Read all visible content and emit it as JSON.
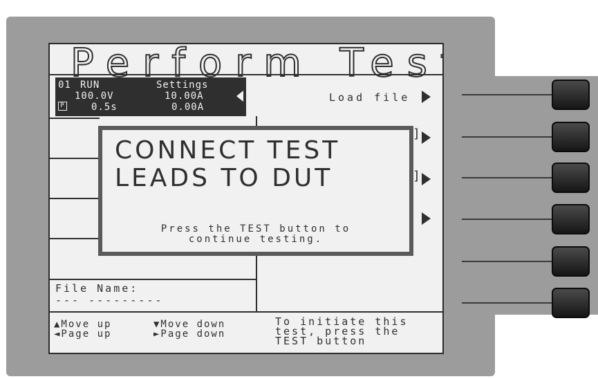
{
  "screen": {
    "title": "Perform Tests",
    "settings": {
      "step": "01",
      "mode": "RUN",
      "header": "Settings",
      "voltage": "100.0V",
      "current_limit": "10.00A",
      "p_badge": "P",
      "time": "0.5s",
      "current": "0.00A"
    },
    "softkeys": {
      "key1_label": "Load file"
    },
    "dialog": {
      "line1": "CONNECT TEST",
      "line2": "LEADS TO DUT",
      "msg1": "Press the TEST button to",
      "msg2": "continue testing."
    },
    "file": {
      "label": "File Name:",
      "value": "--- ---------"
    },
    "nav": {
      "up": "▲Move up",
      "down": "▼Move down",
      "page_up": "◄Page up",
      "page_down": "►Page down"
    },
    "status": {
      "line1": "To initiate this",
      "line2": "test, press the",
      "line3": "TEST button"
    }
  },
  "hardware": {
    "button_count": 6
  }
}
